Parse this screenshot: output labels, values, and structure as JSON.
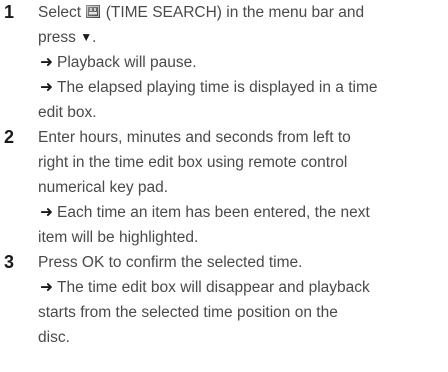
{
  "steps": [
    {
      "number": "1",
      "lines": [
        {
          "pre": "Select ",
          "icon": "time-search-icon",
          "post": " (TIME SEARCH) in the menu bar and"
        },
        {
          "text": "press ",
          "glyph": "▼",
          "after": "."
        },
        {
          "arrow": "➜",
          "text": "Playback will pause."
        },
        {
          "arrow": "➜",
          "text": "The elapsed playing time is displayed in a time"
        },
        {
          "text": "edit box."
        }
      ]
    },
    {
      "number": "2",
      "lines": [
        {
          "text": "Enter hours, minutes and seconds from left to"
        },
        {
          "text": "right in the time edit box using remote control"
        },
        {
          "text": "numerical key pad."
        },
        {
          "arrow": "➜",
          "text": "Each time an item has been entered, the next"
        },
        {
          "text": "item will be highlighted."
        }
      ]
    },
    {
      "number": "3",
      "lines": [
        {
          "text": "Press OK to confirm the selected time."
        },
        {
          "arrow": "➜",
          "text": "The time edit box will disappear and playback"
        },
        {
          "text": "starts from the selected time position on the"
        },
        {
          "text": "disc."
        }
      ]
    }
  ]
}
